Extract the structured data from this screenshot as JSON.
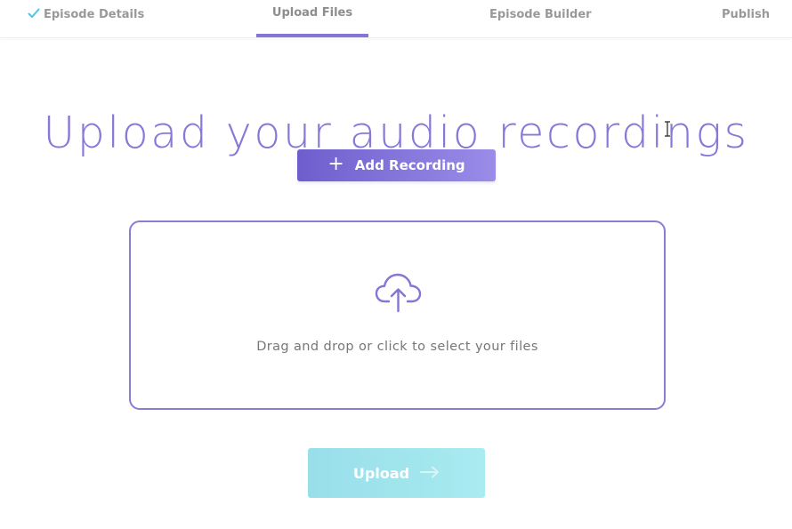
{
  "steps": [
    {
      "label": "Episode Details",
      "state": "completed"
    },
    {
      "label": "Upload Files",
      "state": "active"
    },
    {
      "label": "Episode Builder",
      "state": "pending"
    },
    {
      "label": "Publish",
      "state": "pending"
    }
  ],
  "title": "Upload your audio recordings",
  "add_button": {
    "icon": "plus-icon",
    "label": "Add Recording"
  },
  "dropzone": {
    "icon": "cloud-upload-icon",
    "text": "Drag and drop or click to select your files"
  },
  "upload_button": {
    "label": "Upload",
    "icon": "arrow-right-icon"
  },
  "colors": {
    "accent": "#8475d6",
    "check": "#4fc3e8",
    "upload_button": "#9ae3ec"
  }
}
